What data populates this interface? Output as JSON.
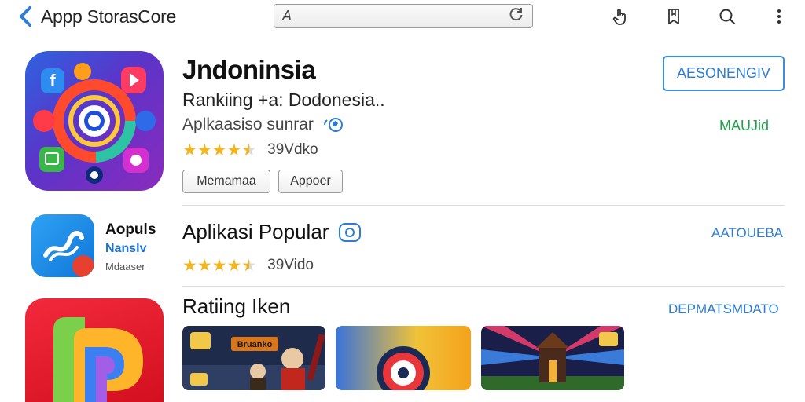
{
  "topbar": {
    "back_label": "Appp StorasCore",
    "search_glyph": "A",
    "search_placeholder": ""
  },
  "featured": {
    "title": "Jndoninsia",
    "subtitle": "Rankiing +a: Dodonesia..",
    "category": "Aplkaasiso sunrar",
    "rating_value": 4.5,
    "rating_text": "39Vdko",
    "btn_1": "Memamaa",
    "btn_2": "Appoer",
    "get_label": "AESONENGIV",
    "status_label": "MAUJid"
  },
  "popular": {
    "app_name_1": "Aopuls",
    "app_name_2": "Nanslv",
    "app_name_3": "Mdaaser",
    "title": "Aplikasi Popular",
    "rating_value": 4.5,
    "rating_text": "39Vido",
    "link_label": "AATOUEBA"
  },
  "rating_section": {
    "title": "Ratiing Iken",
    "link_label": "DEPMATSMDATO",
    "thumbnails": [
      {
        "name": "game-thumb-1",
        "label": "Bruanko"
      },
      {
        "name": "game-thumb-2"
      },
      {
        "name": "game-thumb-3"
      }
    ]
  },
  "colors": {
    "accent": "#2d7dd2",
    "star": "#f2b51e",
    "status_green": "#1fa34a"
  }
}
